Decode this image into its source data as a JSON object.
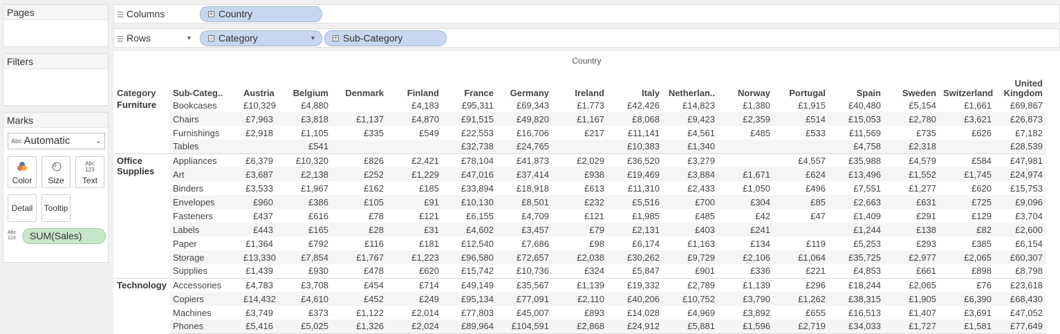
{
  "panels": {
    "pages_title": "Pages",
    "filters_title": "Filters",
    "marks_title": "Marks",
    "mark_type": "Automatic",
    "mark_type_abc": "Abc",
    "mark_buttons": {
      "color": "Color",
      "size": "Size",
      "text": "Text",
      "detail": "Detail",
      "tooltip": "Tooltip"
    },
    "text_icon_top": "Abc",
    "text_icon_bottom": "123",
    "measure_pill": "SUM(Sales)"
  },
  "shelves": {
    "columns_label": "Columns",
    "rows_label": "Rows",
    "columns_pills": [
      "Country"
    ],
    "rows_pills": [
      "Category",
      "Sub-Category"
    ]
  },
  "view": {
    "column_header": "Country",
    "category_header": "Category",
    "subcategory_header": "Sub-Categ..",
    "countries": [
      "Austria",
      "Belgium",
      "Denmark",
      "Finland",
      "France",
      "Germany",
      "Ireland",
      "Italy",
      "Netherlan..",
      "Norway",
      "Portugal",
      "Spain",
      "Sweden",
      "Switzerland",
      "United Kingdom"
    ],
    "groups": [
      {
        "category": "Furniture",
        "rows": [
          {
            "sub": "Bookcases",
            "values": [
              "£10,329",
              "£4,880",
              "",
              "£4,183",
              "£95,311",
              "£69,343",
              "£1,773",
              "£42,426",
              "£14,823",
              "£1,380",
              "£1,915",
              "£40,480",
              "£5,154",
              "£1,661",
              "£69,867"
            ]
          },
          {
            "sub": "Chairs",
            "values": [
              "£7,963",
              "£3,818",
              "£1,137",
              "£4,870",
              "£91,515",
              "£49,820",
              "£1,167",
              "£8,068",
              "£9,423",
              "£2,359",
              "£514",
              "£15,053",
              "£2,780",
              "£3,621",
              "£26,873"
            ]
          },
          {
            "sub": "Furnishings",
            "values": [
              "£2,918",
              "£1,105",
              "£335",
              "£549",
              "£22,553",
              "£16,706",
              "£217",
              "£11,141",
              "£4,561",
              "£485",
              "£533",
              "£11,569",
              "£735",
              "£626",
              "£7,182"
            ]
          },
          {
            "sub": "Tables",
            "values": [
              "",
              "£541",
              "",
              "",
              "£32,738",
              "£24,765",
              "",
              "£10,383",
              "£1,340",
              "",
              "",
              "£4,758",
              "£2,318",
              "",
              "£28,539"
            ]
          }
        ]
      },
      {
        "category": "Office Supplies",
        "rows": [
          {
            "sub": "Appliances",
            "values": [
              "£6,379",
              "£10,320",
              "£826",
              "£2,421",
              "£78,104",
              "£41,873",
              "£2,029",
              "£36,520",
              "£3,279",
              "",
              "£4,557",
              "£35,988",
              "£4,579",
              "£584",
              "£47,981"
            ]
          },
          {
            "sub": "Art",
            "values": [
              "£3,687",
              "£2,138",
              "£252",
              "£1,229",
              "£47,016",
              "£37,414",
              "£938",
              "£19,469",
              "£3,884",
              "£1,671",
              "£624",
              "£13,496",
              "£1,552",
              "£1,745",
              "£24,974"
            ]
          },
          {
            "sub": "Binders",
            "values": [
              "£3,533",
              "£1,967",
              "£162",
              "£185",
              "£33,894",
              "£18,918",
              "£613",
              "£11,310",
              "£2,433",
              "£1,050",
              "£496",
              "£7,551",
              "£1,277",
              "£620",
              "£15,753"
            ]
          },
          {
            "sub": "Envelopes",
            "values": [
              "£960",
              "£386",
              "£105",
              "£91",
              "£10,130",
              "£8,501",
              "£232",
              "£5,516",
              "£700",
              "£304",
              "£85",
              "£2,663",
              "£631",
              "£725",
              "£9,096"
            ]
          },
          {
            "sub": "Fasteners",
            "values": [
              "£437",
              "£616",
              "£78",
              "£121",
              "£6,155",
              "£4,709",
              "£121",
              "£1,985",
              "£485",
              "£42",
              "£47",
              "£1,409",
              "£291",
              "£129",
              "£3,704"
            ]
          },
          {
            "sub": "Labels",
            "values": [
              "£443",
              "£165",
              "£28",
              "£31",
              "£4,602",
              "£3,457",
              "£79",
              "£2,131",
              "£403",
              "£241",
              "",
              "£1,244",
              "£138",
              "£82",
              "£2,600"
            ]
          },
          {
            "sub": "Paper",
            "values": [
              "£1,364",
              "£792",
              "£116",
              "£181",
              "£12,540",
              "£7,686",
              "£98",
              "£6,174",
              "£1,163",
              "£134",
              "£119",
              "£5,253",
              "£293",
              "£385",
              "£6,154"
            ]
          },
          {
            "sub": "Storage",
            "values": [
              "£13,330",
              "£7,854",
              "£1,767",
              "£1,223",
              "£96,580",
              "£72,657",
              "£2,038",
              "£30,262",
              "£9,729",
              "£2,106",
              "£1,064",
              "£35,725",
              "£2,977",
              "£2,065",
              "£60,307"
            ]
          },
          {
            "sub": "Supplies",
            "values": [
              "£1,439",
              "£930",
              "£478",
              "£620",
              "£15,742",
              "£10,736",
              "£324",
              "£5,847",
              "£901",
              "£336",
              "£221",
              "£4,853",
              "£661",
              "£898",
              "£8,798"
            ]
          }
        ]
      },
      {
        "category": "Technology",
        "rows": [
          {
            "sub": "Accessories",
            "values": [
              "£4,783",
              "£3,708",
              "£454",
              "£714",
              "£49,149",
              "£35,567",
              "£1,139",
              "£19,332",
              "£2,789",
              "£1,139",
              "£296",
              "£18,244",
              "£2,065",
              "£76",
              "£23,618"
            ]
          },
          {
            "sub": "Copiers",
            "values": [
              "£14,432",
              "£4,610",
              "£452",
              "£249",
              "£95,134",
              "£77,091",
              "£2,110",
              "£40,206",
              "£10,752",
              "£3,790",
              "£1,262",
              "£38,315",
              "£1,905",
              "£6,390",
              "£68,430"
            ]
          },
          {
            "sub": "Machines",
            "values": [
              "£3,749",
              "£373",
              "£1,122",
              "£2,014",
              "£77,803",
              "£45,007",
              "£893",
              "£14,028",
              "£4,969",
              "£3,892",
              "£655",
              "£16,513",
              "£1,407",
              "£3,691",
              "£47,052"
            ]
          },
          {
            "sub": "Phones",
            "values": [
              "£5,416",
              "£5,025",
              "£1,326",
              "£2,024",
              "£89,964",
              "£104,591",
              "£2,868",
              "£24,912",
              "£5,881",
              "£1,596",
              "£2,719",
              "£34,033",
              "£1,727",
              "£1,581",
              "£77,649"
            ]
          }
        ]
      }
    ]
  },
  "colors": {
    "dimension_pill": "#c7d7ef",
    "measure_pill": "#c8e6c9",
    "band": "#f5f5f5"
  }
}
